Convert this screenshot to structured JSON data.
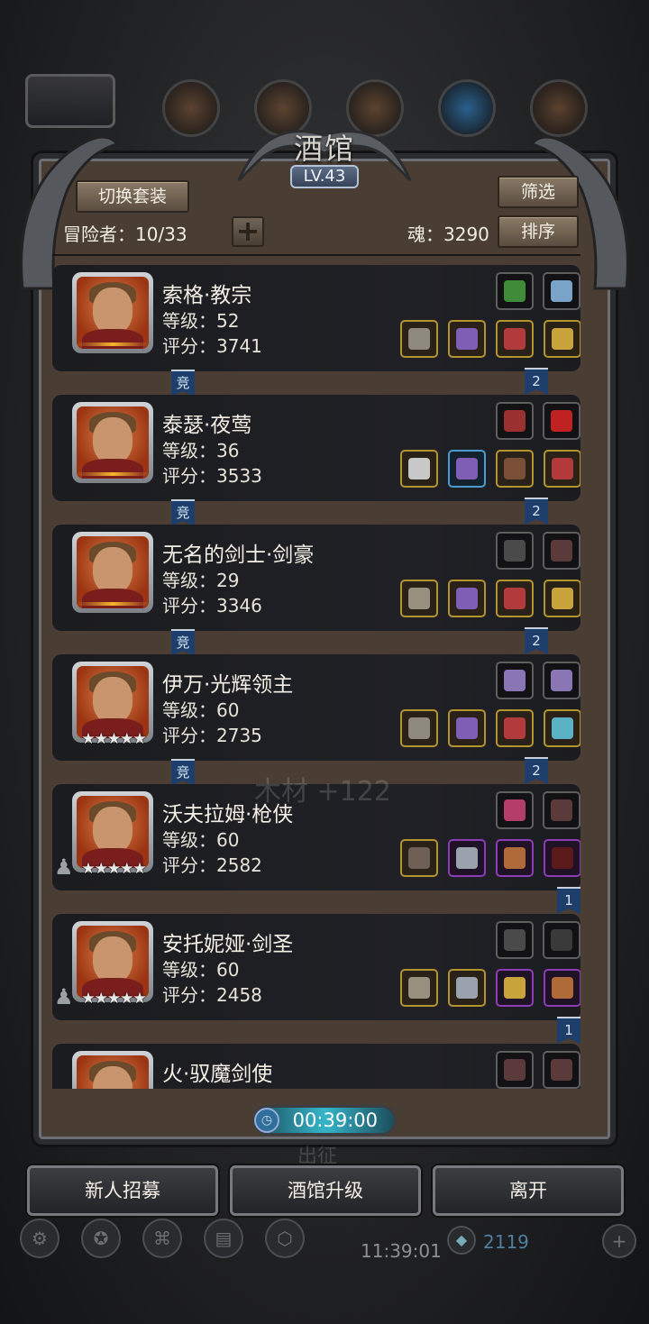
{
  "header": {
    "title": "酒馆",
    "level": "LV.43",
    "switch_outfit": "切换套装",
    "filter": "筛选",
    "sort": "排序",
    "adventurers_label": "冒险者：10/33",
    "soul_label": "魂：3290",
    "add": "+"
  },
  "heroes": [
    {
      "name": "索格·教宗",
      "level": "等级：52",
      "score": "评分：3741",
      "badge": "moon",
      "left_tag": "竞",
      "right_tag": "2",
      "top_slots": [
        "green-book-icon",
        "necklace-icon"
      ],
      "bottom_slots": [
        "hammer-icon",
        "helmet-purple-icon",
        "red-helmet-icon",
        "ring-icon"
      ],
      "bottom_quality": [
        "g",
        "g",
        "g",
        "g"
      ],
      "top_quality": [
        "n",
        "n"
      ]
    },
    {
      "name": "泰瑟·夜莺",
      "level": "等级：36",
      "score": "评分：3533",
      "badge": "moon",
      "left_tag": "竞",
      "right_tag": "2",
      "top_slots": [
        "red-feather-icon",
        "red-gem-icon"
      ],
      "bottom_slots": [
        "curved-blade-icon",
        "helmet-purple-icon",
        "leather-armor-icon",
        "red-helmet-icon"
      ],
      "bottom_quality": [
        "g",
        "b",
        "g",
        "g"
      ],
      "top_quality": [
        "n",
        "n"
      ]
    },
    {
      "name": "无名的剑士·剑豪",
      "level": "等级：29",
      "score": "评分：3346",
      "badge": "moon",
      "left_tag": "竞",
      "right_tag": "2",
      "top_slots": [
        "gauntlet-icon",
        "feather-icon"
      ],
      "bottom_slots": [
        "sword-icon",
        "helmet-purple-icon",
        "red-helmet-icon",
        "ring-icon"
      ],
      "bottom_quality": [
        "g",
        "g",
        "g",
        "g"
      ],
      "top_quality": [
        "n",
        "n"
      ]
    },
    {
      "name": "伊万·光辉领主",
      "level": "等级：60",
      "score": "评分：2735",
      "badge": "stars",
      "stars": "★★★★★",
      "left_tag": "竞",
      "right_tag": "2",
      "top_slots": [
        "crystal-icon",
        "crystal-icon"
      ],
      "bottom_slots": [
        "hammer-icon",
        "helmet-purple-icon",
        "red-helmet-icon",
        "blue-orb-icon"
      ],
      "bottom_quality": [
        "g",
        "g",
        "g",
        "g"
      ],
      "top_quality": [
        "n",
        "n"
      ]
    },
    {
      "name": "沃夫拉姆·枪侠",
      "level": "等级：60",
      "score": "评分：2582",
      "badge": "stars",
      "stars": "★★★★★",
      "left_tag": "",
      "right_tag": "1",
      "top_slots": [
        "potion-icon",
        "feather-icon"
      ],
      "bottom_slots": [
        "rifle-icon",
        "armor-icon",
        "scroll-icon",
        "dark-cape-icon"
      ],
      "bottom_quality": [
        "g",
        "p",
        "p",
        "p"
      ],
      "top_quality": [
        "n",
        "n"
      ]
    },
    {
      "name": "安托妮娅·剑圣",
      "level": "等级：60",
      "score": "评分：2458",
      "badge": "stars",
      "stars": "★★★★★",
      "left_tag": "",
      "right_tag": "1",
      "top_slots": [
        "gauntlet-icon",
        "boot-icon"
      ],
      "bottom_slots": [
        "sword-icon",
        "armor-icon",
        "ring-icon",
        "scroll-icon"
      ],
      "bottom_quality": [
        "g",
        "g",
        "p",
        "p"
      ],
      "top_quality": [
        "n",
        "n"
      ]
    },
    {
      "name": "火·驭魔剑使",
      "level": "",
      "score": "",
      "badge": "none",
      "left_tag": "",
      "right_tag": "",
      "top_slots": [
        "feather-icon",
        "feather-icon"
      ],
      "bottom_slots": [],
      "bottom_quality": [],
      "top_quality": [
        "n",
        "n"
      ]
    }
  ],
  "overlay": {
    "wood_float": "木材 +122",
    "expedition": "出征"
  },
  "timer": "00:39:00",
  "buttons": {
    "recruit": "新人招募",
    "upgrade": "酒馆升级",
    "leave": "离开"
  },
  "bottom_bar": {
    "clock": "11:39:01",
    "gems": "2119"
  },
  "colors": {
    "tag_blue": "#1e3e6b",
    "gold_border": "#b3952f",
    "purple_border": "#8a3db6",
    "blue_border": "#4b9bd1",
    "timer_teal": "#35b5c9"
  }
}
